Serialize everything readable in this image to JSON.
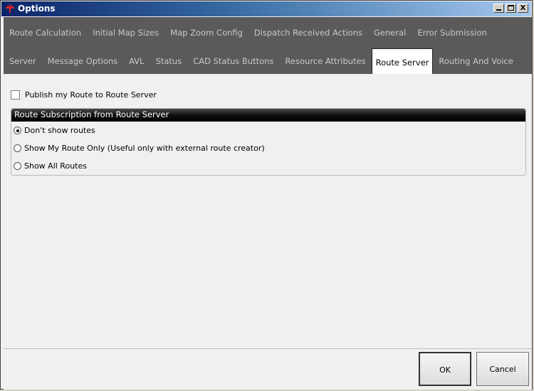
{
  "window": {
    "title": "Options",
    "controls": {
      "minimize": "_",
      "maximize": "□",
      "close": "X"
    }
  },
  "tabs": {
    "row1": [
      {
        "label": "Route Calculation"
      },
      {
        "label": "Initial Map Sizes"
      },
      {
        "label": "Map Zoom Config"
      },
      {
        "label": "Dispatch Received Actions"
      },
      {
        "label": "General"
      },
      {
        "label": "Error Submission"
      }
    ],
    "row2": [
      {
        "label": "Server"
      },
      {
        "label": "Message Options"
      },
      {
        "label": "AVL"
      },
      {
        "label": "Status"
      },
      {
        "label": "CAD Status Buttons"
      },
      {
        "label": "Resource Attributes"
      },
      {
        "label": "Route Server",
        "active": true
      },
      {
        "label": "Routing And Voice"
      }
    ]
  },
  "route_server": {
    "publish_label": "Publish my Route to Route Server",
    "publish_checked": false,
    "subscription": {
      "header": "Route Subscription from Route Server",
      "options": [
        {
          "label": "Don't show routes",
          "checked": true
        },
        {
          "label": "Show My Route Only (Useful only with external route creator)",
          "checked": false
        },
        {
          "label": "Show All Routes",
          "checked": false
        }
      ]
    }
  },
  "footer": {
    "ok_label": "OK",
    "cancel_label": "Cancel"
  },
  "colors": {
    "tab_strip_bg": "#5a5a5a",
    "group_header_bg": "#111111"
  }
}
